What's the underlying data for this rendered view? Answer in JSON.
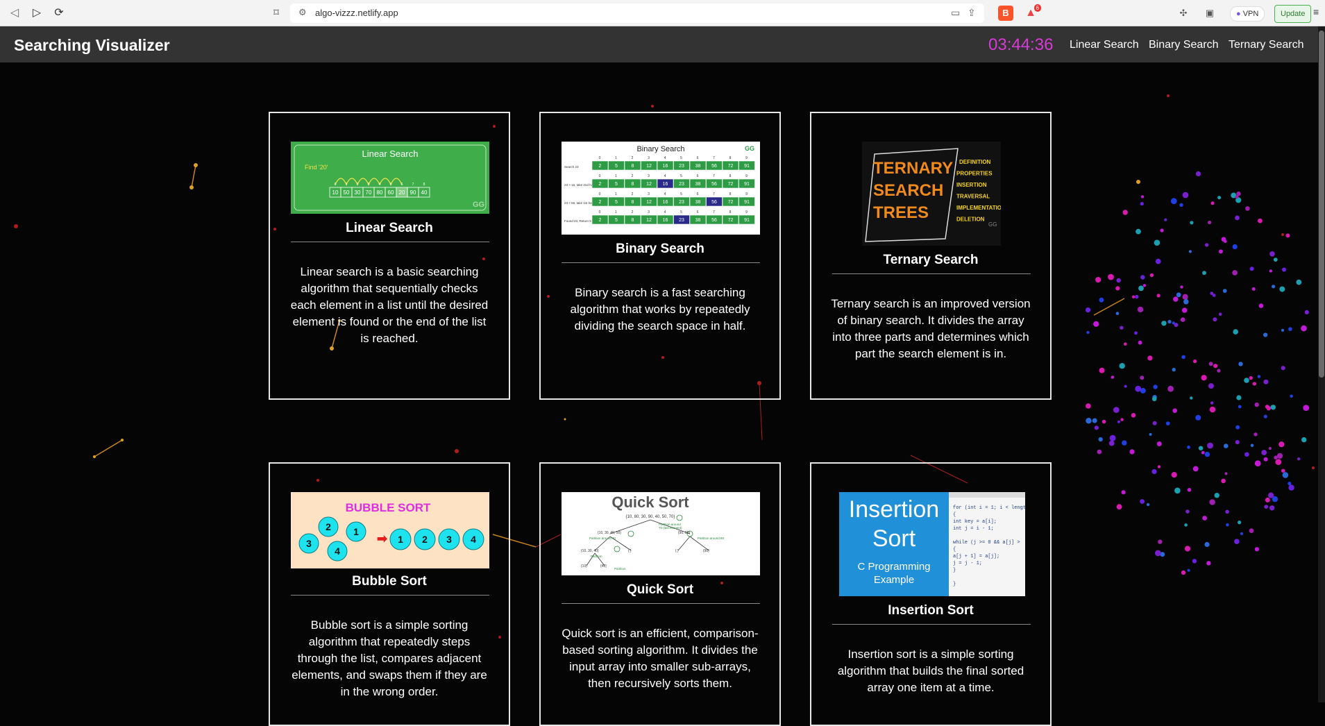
{
  "browser": {
    "url": "algo-vizzz.netlify.app",
    "vpn_label": "VPN",
    "update_label": "Update",
    "brave_badge": "6"
  },
  "header": {
    "title": "Searching Visualizer",
    "timer": "03:44:36",
    "nav": [
      "Linear Search",
      "Binary Search",
      "Ternary Search"
    ]
  },
  "cards": [
    {
      "title": "Linear Search",
      "description": "Linear search is a basic searching algorithm that sequentially checks each element in a list until the desired element is found or the end of the list is reached.",
      "image": {
        "heading": "Linear Search",
        "find_label": "Find '20'",
        "cells": [
          "10",
          "50",
          "30",
          "70",
          "80",
          "60",
          "20",
          "90",
          "40"
        ],
        "indices": [
          "0",
          "1",
          "2",
          "3",
          "4",
          "5",
          "6",
          "7",
          "8"
        ],
        "logo": "GG"
      }
    },
    {
      "title": "Binary Search",
      "description": "Binary search is a fast searching algorithm that works by repeatedly dividing the search space in half.",
      "image": {
        "heading": "Binary Search",
        "logo": "GG",
        "indices": [
          "0",
          "1",
          "2",
          "3",
          "4",
          "5",
          "6",
          "7",
          "8",
          "9"
        ],
        "values": [
          "2",
          "5",
          "8",
          "12",
          "16",
          "23",
          "38",
          "56",
          "72",
          "91"
        ],
        "row_labels": [
          "Search 23",
          "23 > 16, take 2nd half",
          "23 < 56, take 1st half",
          "Found 23, Return 5"
        ]
      }
    },
    {
      "title": "Ternary Search",
      "description": "Ternary search is an improved version of binary search. It divides the array into three parts and determines which part the search element is in.",
      "image": {
        "title_lines": [
          "TERNARY",
          "SEARCH",
          "TREES"
        ],
        "topics": [
          "DEFINITION",
          "PROPERTIES",
          "INSERTION",
          "TRAVERSAL",
          "IMPLEMENTATION",
          "DELETION"
        ],
        "logo": "GG"
      }
    },
    {
      "title": "Bubble Sort",
      "description": "Bubble sort is a simple sorting algorithm that repeatedly steps through the list, compares adjacent elements, and swaps them if they are in the wrong order.",
      "image": {
        "heading": "BUBBLE SORT",
        "unsorted": [
          "3",
          "2",
          "1",
          "4"
        ],
        "sorted": [
          "1",
          "2",
          "3",
          "4"
        ]
      }
    },
    {
      "title": "Quick Sort",
      "description": "Quick sort is an efficient, comparison-based sorting algorithm. It divides the input array into smaller sub-arrays, then recursively sorts them.",
      "image": {
        "heading": "Quick Sort",
        "root_array": "{10, 80, 30, 90, 40, 50, 70}"
      }
    },
    {
      "title": "Insertion Sort",
      "description": "Insertion sort is a simple sorting algorithm that builds the final sorted array one item at a time.",
      "image": {
        "title_lines": [
          "Insertion",
          "Sort"
        ],
        "subtitle_lines": [
          "C Programming",
          "Example"
        ],
        "code_lines": [
          "for (int i = 1; i < lengt",
          "{",
          "  int key = a[i];",
          "  int j = i - 1;",
          "",
          "  while (j >= 0 && a[j] >",
          "  {",
          "    a[j + 1] = a[j];",
          "    j = j - 1;",
          "  }",
          "",
          "}"
        ]
      }
    }
  ],
  "colors": {
    "page_bg": "#050505",
    "header_bg": "#333333",
    "timer": "#d63bd6",
    "card_border": "#e8e8e8"
  }
}
